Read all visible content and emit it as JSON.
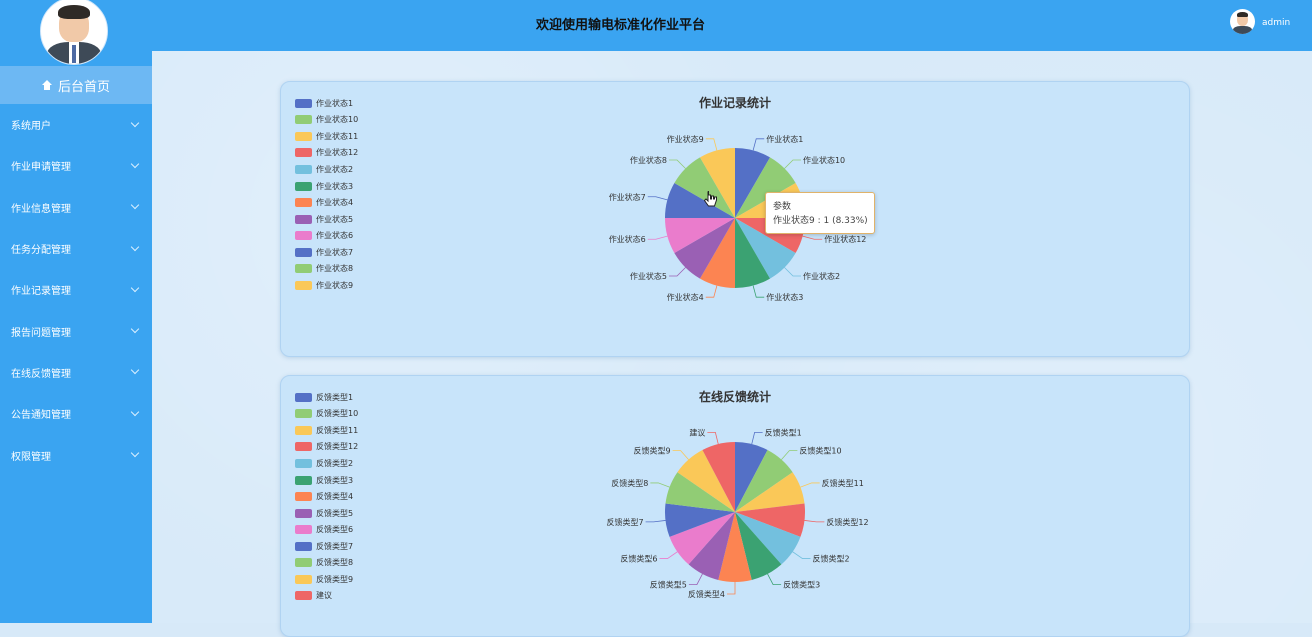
{
  "header": {
    "title": "欢迎使用输电标准化作业平台",
    "user": "admin"
  },
  "sidebar": {
    "home_label": "后台首页",
    "items": [
      {
        "label": "系统用户"
      },
      {
        "label": "作业申请管理"
      },
      {
        "label": "作业信息管理"
      },
      {
        "label": "任务分配管理"
      },
      {
        "label": "作业记录管理"
      },
      {
        "label": "报告问题管理"
      },
      {
        "label": "在线反馈管理"
      },
      {
        "label": "公告通知管理"
      },
      {
        "label": "权限管理"
      }
    ]
  },
  "colors": {
    "palette": [
      "#5470c6",
      "#91cc75",
      "#fac858",
      "#ee6666",
      "#73c0de",
      "#3ba272",
      "#fc8452",
      "#9a60b4",
      "#ea7ccc"
    ],
    "sidebar": "#3aa4f1",
    "header": "#3aa4f1"
  },
  "tooltip": {
    "title": "参数",
    "text": "作业状态9 : 1 (8.33%)"
  },
  "chart_data": [
    {
      "type": "pie",
      "title": "作业记录统计",
      "legend_position": "top-left",
      "slices": [
        {
          "name": "作业状态1",
          "value": 1
        },
        {
          "name": "作业状态10",
          "value": 1
        },
        {
          "name": "作业状态11",
          "value": 1
        },
        {
          "name": "作业状态12",
          "value": 1
        },
        {
          "name": "作业状态2",
          "value": 1
        },
        {
          "name": "作业状态3",
          "value": 1
        },
        {
          "name": "作业状态4",
          "value": 1
        },
        {
          "name": "作业状态5",
          "value": 1
        },
        {
          "name": "作业状态6",
          "value": 1
        },
        {
          "name": "作业状态7",
          "value": 1
        },
        {
          "name": "作业状态8",
          "value": 1
        },
        {
          "name": "作业状态9",
          "value": 1
        }
      ]
    },
    {
      "type": "pie",
      "title": "在线反馈统计",
      "legend_position": "top-left",
      "slices": [
        {
          "name": "反馈类型1",
          "value": 1
        },
        {
          "name": "反馈类型10",
          "value": 1
        },
        {
          "name": "反馈类型11",
          "value": 1
        },
        {
          "name": "反馈类型12",
          "value": 1
        },
        {
          "name": "反馈类型2",
          "value": 1
        },
        {
          "name": "反馈类型3",
          "value": 1
        },
        {
          "name": "反馈类型4",
          "value": 1
        },
        {
          "name": "反馈类型5",
          "value": 1
        },
        {
          "name": "反馈类型6",
          "value": 1
        },
        {
          "name": "反馈类型7",
          "value": 1
        },
        {
          "name": "反馈类型8",
          "value": 1
        },
        {
          "name": "反馈类型9",
          "value": 1
        },
        {
          "name": "建议",
          "value": 1
        }
      ]
    }
  ]
}
